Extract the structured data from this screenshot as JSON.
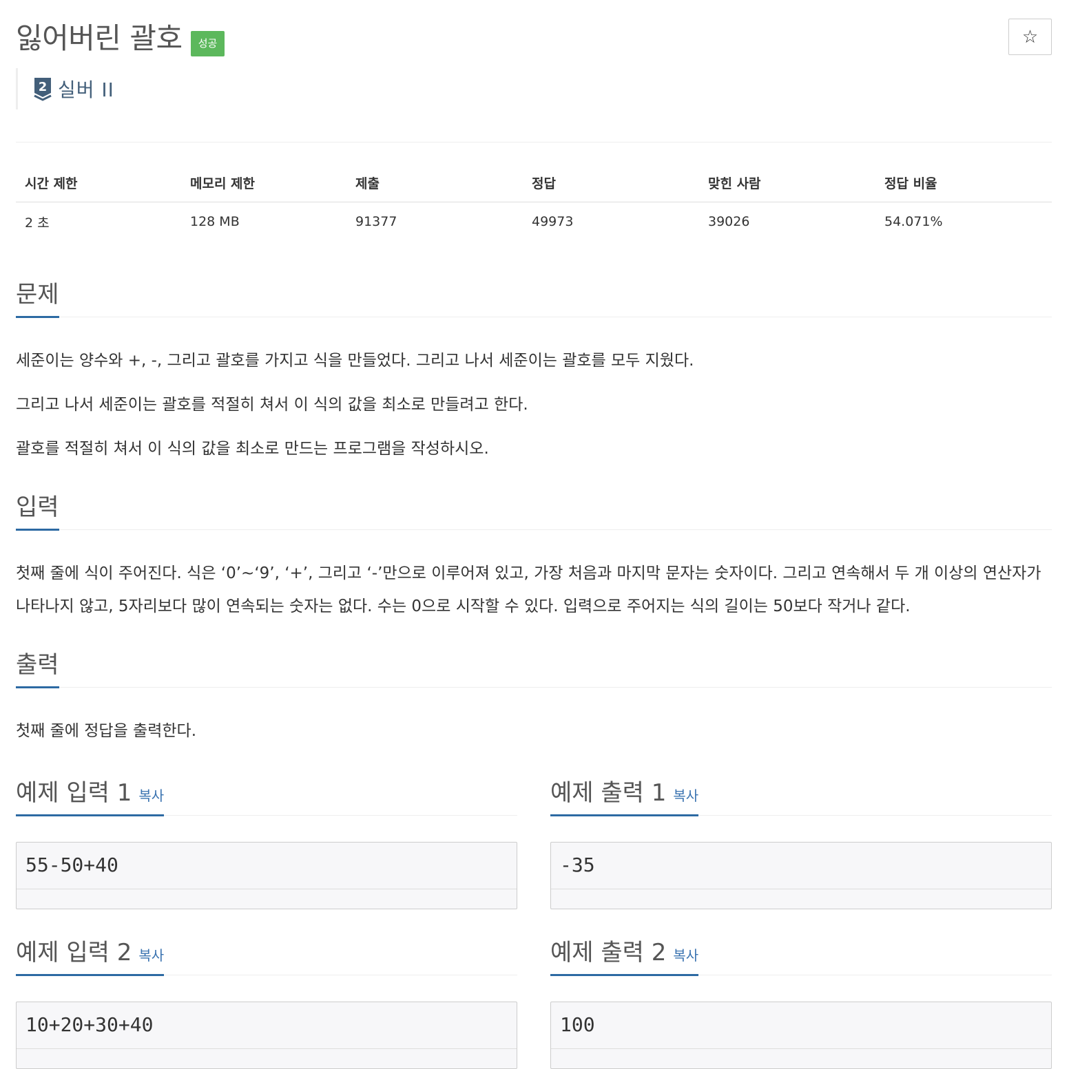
{
  "problem": {
    "title": "잃어버린 괄호",
    "status": "성공",
    "star_icon": "☆",
    "tier": "실버 II",
    "tier_number": "2",
    "tier_color": "#435f7a"
  },
  "info": {
    "headers": [
      "시간 제한",
      "메모리 제한",
      "제출",
      "정답",
      "맞힌 사람",
      "정답 비율"
    ],
    "values": [
      "2 초",
      "128 MB",
      "91377",
      "49973",
      "39026",
      "54.071%"
    ]
  },
  "sections": {
    "problem": {
      "title": "문제",
      "paragraphs": [
        "세준이는 양수와 +, -, 그리고 괄호를 가지고 식을 만들었다. 그리고 나서 세준이는 괄호를 모두 지웠다.",
        "그리고 나서 세준이는 괄호를 적절히 쳐서 이 식의 값을 최소로 만들려고 한다.",
        "괄호를 적절히 쳐서 이 식의 값을 최소로 만드는 프로그램을 작성하시오."
      ]
    },
    "input": {
      "title": "입력",
      "text": "첫째 줄에 식이 주어진다. 식은 ‘0’~‘9’, ‘+’, 그리고 ‘-’만으로 이루어져 있고, 가장 처음과 마지막 문자는 숫자이다. 그리고 연속해서 두 개 이상의 연산자가 나타나지 않고, 5자리보다 많이 연속되는 숫자는 없다. 수는 0으로 시작할 수 있다. 입력으로 주어지는 식의 길이는 50보다 작거나 같다."
    },
    "output": {
      "title": "출력",
      "text": "첫째 줄에 정답을 출력한다."
    }
  },
  "samples": {
    "copy_label": "복사",
    "input1": {
      "title": "예제 입력 1",
      "code": "55-50+40"
    },
    "output1": {
      "title": "예제 출력 1",
      "code": "-35"
    },
    "input2": {
      "title": "예제 입력 2",
      "code": "10+20+30+40"
    },
    "output2": {
      "title": "예제 출력 2",
      "code": "100"
    }
  },
  "colors": {
    "status_green": "#5cb85c",
    "accent_blue": "#2d6aa3",
    "link_blue": "#3a73b0"
  }
}
